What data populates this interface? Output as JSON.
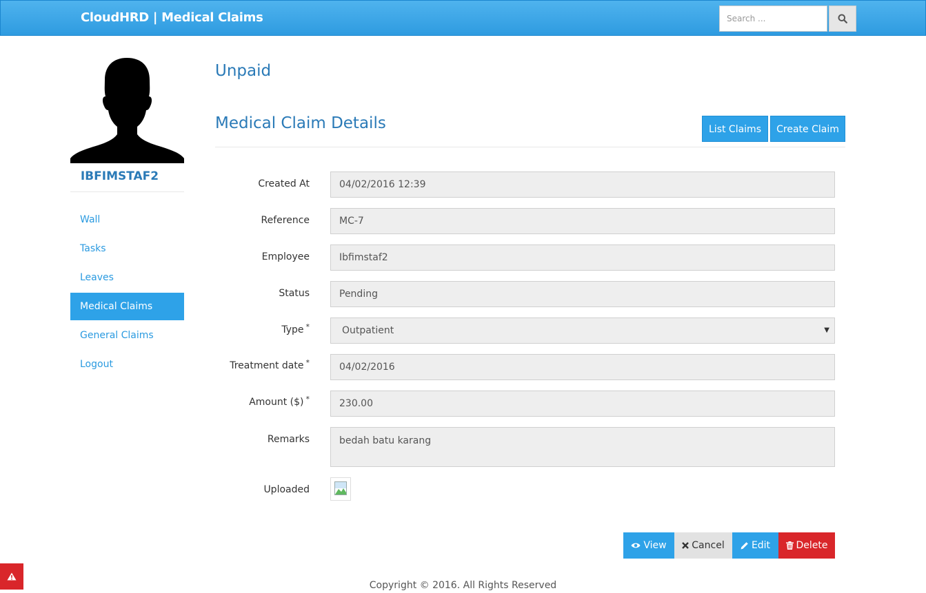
{
  "app": {
    "brand": "CloudHRD | Medical Claims"
  },
  "search": {
    "placeholder": "Search ..."
  },
  "icons": {
    "search": "search-icon",
    "view": "eye-icon",
    "cancel": "times-icon",
    "edit": "pencil-icon",
    "delete": "trash-icon",
    "alert": "warning-icon"
  },
  "colors": {
    "primary": "#2ea2e8",
    "danger": "#d9262a",
    "heading": "#2a7ab7"
  },
  "sidebar": {
    "username": "IBFIMSTAF2",
    "items": [
      {
        "label": "Wall",
        "active": false
      },
      {
        "label": "Tasks",
        "active": false
      },
      {
        "label": "Leaves",
        "active": false
      },
      {
        "label": "Medical Claims",
        "active": true
      },
      {
        "label": "General Claims",
        "active": false
      },
      {
        "label": "Logout",
        "active": false
      }
    ]
  },
  "main": {
    "status_heading": "Unpaid",
    "section_title": "Medical Claim Details",
    "buttons": {
      "list_claims": "List Claims",
      "create_claim": "Create Claim"
    },
    "fields": {
      "created_at": {
        "label": "Created At",
        "value": "04/02/2016 12:39"
      },
      "reference": {
        "label": "Reference",
        "value": "MC-7"
      },
      "employee": {
        "label": "Employee",
        "value": "Ibfimstaf2"
      },
      "status": {
        "label": "Status",
        "value": "Pending"
      },
      "type": {
        "label": "Type",
        "value": "Outpatient",
        "required": "*"
      },
      "treatment_date": {
        "label": "Treatment date",
        "value": "04/02/2016",
        "required": "*"
      },
      "amount": {
        "label": "Amount ($)",
        "value": "230.00",
        "required": "*"
      },
      "remarks": {
        "label": "Remarks",
        "value": "bedah batu karang"
      },
      "uploaded": {
        "label": "Uploaded"
      }
    },
    "actions": {
      "view": "View",
      "cancel": "Cancel",
      "edit": "Edit",
      "delete": "Delete"
    }
  },
  "footer": {
    "text": "Copyright © 2016. All Rights Reserved"
  }
}
